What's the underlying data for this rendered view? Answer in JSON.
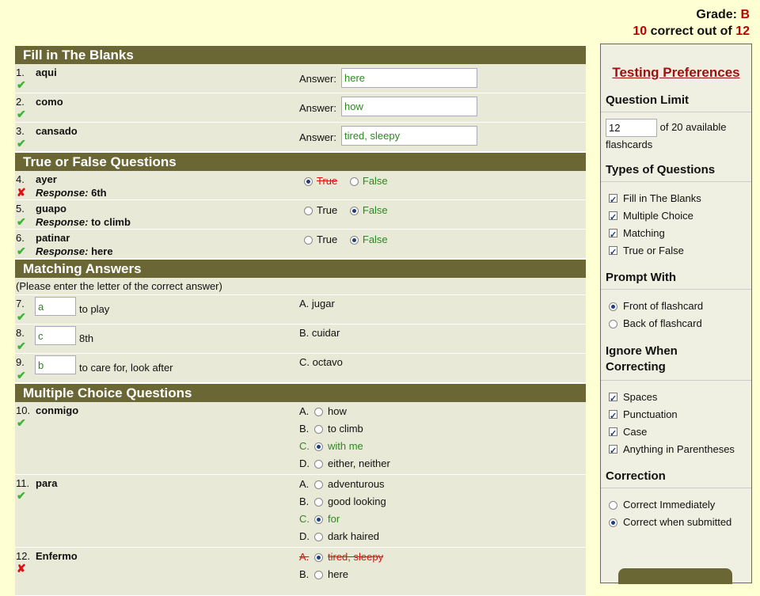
{
  "grade": {
    "label": "Grade:",
    "value": "B",
    "correct": "10",
    "mid": "correct out of",
    "total": "12"
  },
  "sections": {
    "fill": "Fill in The Blanks",
    "tf": "True or False Questions",
    "match": "Matching Answers",
    "mc": "Multiple Choice Questions"
  },
  "answer_label": "Answer:",
  "response_label": "Response:",
  "fill": [
    {
      "num": "1.",
      "word": "aqui",
      "answer": "here"
    },
    {
      "num": "2.",
      "word": "como",
      "answer": "how"
    },
    {
      "num": "3.",
      "word": "cansado",
      "answer": "tired, sleepy"
    }
  ],
  "tf": [
    {
      "num": "4.",
      "word": "ayer",
      "response": "6th",
      "true_label": "True",
      "false_label": "False"
    },
    {
      "num": "5.",
      "word": "guapo",
      "response": "to climb",
      "true_label": "True",
      "false_label": "False"
    },
    {
      "num": "6.",
      "word": "patinar",
      "response": "here",
      "true_label": "True",
      "false_label": "False"
    }
  ],
  "match_note": "(Please enter the letter of the correct answer)",
  "match": [
    {
      "num": "7.",
      "input": "a",
      "prompt": "to play",
      "option": "A. jugar"
    },
    {
      "num": "8.",
      "input": "c",
      "prompt": "8th",
      "option": "B. cuidar"
    },
    {
      "num": "9.",
      "input": "b",
      "prompt": "to care for, look after",
      "option": "C. octavo"
    }
  ],
  "mc": [
    {
      "num": "10.",
      "word": "conmigo",
      "options": [
        {
          "letter": "A.",
          "text": "how"
        },
        {
          "letter": "B.",
          "text": "to climb"
        },
        {
          "letter": "C.",
          "text": "with me"
        },
        {
          "letter": "D.",
          "text": "either, neither"
        }
      ]
    },
    {
      "num": "11.",
      "word": "para",
      "options": [
        {
          "letter": "A.",
          "text": "adventurous"
        },
        {
          "letter": "B.",
          "text": "good looking"
        },
        {
          "letter": "C.",
          "text": "for"
        },
        {
          "letter": "D.",
          "text": "dark haired"
        }
      ]
    },
    {
      "num": "12.",
      "word": "Enfermo",
      "options": [
        {
          "letter": "A.",
          "text": "tired, sleepy"
        },
        {
          "letter": "B.",
          "text": "here"
        }
      ]
    }
  ],
  "prefs": {
    "title": "Testing Preferences",
    "question_limit": "Question Limit",
    "limit_value": "12",
    "limit_text": "of 20 available",
    "limit_text2": "flashcards",
    "types_heading": "Types of Questions",
    "types": [
      "Fill in The Blanks",
      "Multiple Choice",
      "Matching",
      "True or False"
    ],
    "prompt_heading": "Prompt With",
    "prompt": [
      "Front of flashcard",
      "Back of flashcard"
    ],
    "ignore_heading1": "Ignore When",
    "ignore_heading2": "Correcting",
    "ignore": [
      "Spaces",
      "Punctuation",
      "Case",
      "Anything in Parentheses"
    ],
    "correction_heading": "Correction",
    "correction": [
      "Correct Immediately",
      "Correct when submitted"
    ]
  },
  "colors": {
    "section_bar": "#6B6734",
    "row_bg": "#E9E9D7",
    "page_bg": "#FFFFD4",
    "correct_green": "#2A8A1E",
    "wrong_red": "#D11111"
  }
}
